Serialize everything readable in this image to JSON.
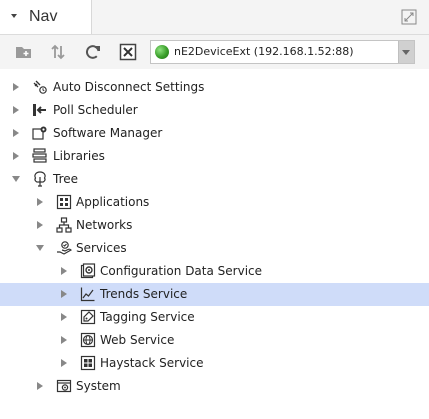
{
  "nav_tab": {
    "title": "Nav"
  },
  "toolbar": {
    "buttons": [
      "new-folder-icon",
      "sync-arrows-icon",
      "refresh-icon",
      "close-icon"
    ]
  },
  "device_selector": {
    "value": "nE2DeviceExt (192.168.1.52:88)",
    "status_color": "#3a9e2a"
  },
  "tree": {
    "auto_disconnect": "Auto Disconnect Settings",
    "poll_scheduler": "Poll Scheduler",
    "software_manager": "Software Manager",
    "libraries": "Libraries",
    "tree": "Tree",
    "applications": "Applications",
    "networks": "Networks",
    "services": "Services",
    "configuration_data_service": "Configuration Data Service",
    "trends_service": "Trends Service",
    "tagging_service": "Tagging Service",
    "web_service": "Web Service",
    "haystack_service": "Haystack Service",
    "system": "System"
  },
  "colors": {
    "selection": "#cfdcf9",
    "toolbar_bg": "#f4f4f4"
  }
}
